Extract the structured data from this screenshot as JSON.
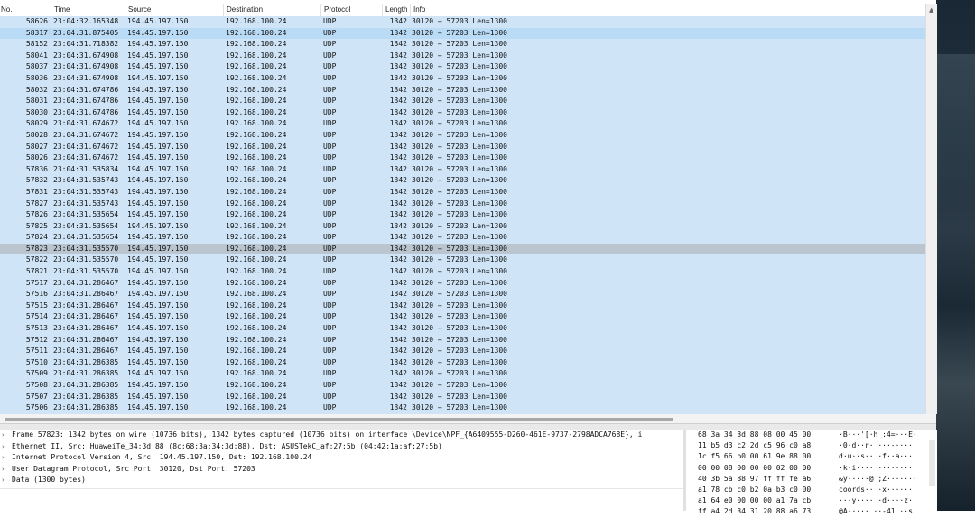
{
  "columns": {
    "no": "No.",
    "time": "Time",
    "source": "Source",
    "destination": "Destination",
    "protocol": "Protocol",
    "length": "Length",
    "info": "Info"
  },
  "colors": {
    "row_bg": "#cfe5f7",
    "selected_bg": "#bac5cf",
    "hover_bg": "#b9dbf6"
  },
  "packets": [
    {
      "no": "58626",
      "time": "23:04:32.165348",
      "source": "194.45.197.150",
      "destination": "192.168.100.24",
      "protocol": "UDP",
      "length": "1342",
      "info": "30120 → 57203 Len=1300"
    },
    {
      "no": "58317",
      "time": "23:04:31.875405",
      "source": "194.45.197.150",
      "destination": "192.168.100.24",
      "protocol": "UDP",
      "length": "1342",
      "info": "30120 → 57203 Len=1300"
    },
    {
      "no": "58152",
      "time": "23:04:31.718382",
      "source": "194.45.197.150",
      "destination": "192.168.100.24",
      "protocol": "UDP",
      "length": "1342",
      "info": "30120 → 57203 Len=1300"
    },
    {
      "no": "58041",
      "time": "23:04:31.674908",
      "source": "194.45.197.150",
      "destination": "192.168.100.24",
      "protocol": "UDP",
      "length": "1342",
      "info": "30120 → 57203 Len=1300"
    },
    {
      "no": "58037",
      "time": "23:04:31.674908",
      "source": "194.45.197.150",
      "destination": "192.168.100.24",
      "protocol": "UDP",
      "length": "1342",
      "info": "30120 → 57203 Len=1300"
    },
    {
      "no": "58036",
      "time": "23:04:31.674908",
      "source": "194.45.197.150",
      "destination": "192.168.100.24",
      "protocol": "UDP",
      "length": "1342",
      "info": "30120 → 57203 Len=1300"
    },
    {
      "no": "58032",
      "time": "23:04:31.674786",
      "source": "194.45.197.150",
      "destination": "192.168.100.24",
      "protocol": "UDP",
      "length": "1342",
      "info": "30120 → 57203 Len=1300"
    },
    {
      "no": "58031",
      "time": "23:04:31.674786",
      "source": "194.45.197.150",
      "destination": "192.168.100.24",
      "protocol": "UDP",
      "length": "1342",
      "info": "30120 → 57203 Len=1300"
    },
    {
      "no": "58030",
      "time": "23:04:31.674786",
      "source": "194.45.197.150",
      "destination": "192.168.100.24",
      "protocol": "UDP",
      "length": "1342",
      "info": "30120 → 57203 Len=1300"
    },
    {
      "no": "58029",
      "time": "23:04:31.674672",
      "source": "194.45.197.150",
      "destination": "192.168.100.24",
      "protocol": "UDP",
      "length": "1342",
      "info": "30120 → 57203 Len=1300"
    },
    {
      "no": "58028",
      "time": "23:04:31.674672",
      "source": "194.45.197.150",
      "destination": "192.168.100.24",
      "protocol": "UDP",
      "length": "1342",
      "info": "30120 → 57203 Len=1300"
    },
    {
      "no": "58027",
      "time": "23:04:31.674672",
      "source": "194.45.197.150",
      "destination": "192.168.100.24",
      "protocol": "UDP",
      "length": "1342",
      "info": "30120 → 57203 Len=1300"
    },
    {
      "no": "58026",
      "time": "23:04:31.674672",
      "source": "194.45.197.150",
      "destination": "192.168.100.24",
      "protocol": "UDP",
      "length": "1342",
      "info": "30120 → 57203 Len=1300"
    },
    {
      "no": "57836",
      "time": "23:04:31.535834",
      "source": "194.45.197.150",
      "destination": "192.168.100.24",
      "protocol": "UDP",
      "length": "1342",
      "info": "30120 → 57203 Len=1300"
    },
    {
      "no": "57832",
      "time": "23:04:31.535743",
      "source": "194.45.197.150",
      "destination": "192.168.100.24",
      "protocol": "UDP",
      "length": "1342",
      "info": "30120 → 57203 Len=1300"
    },
    {
      "no": "57831",
      "time": "23:04:31.535743",
      "source": "194.45.197.150",
      "destination": "192.168.100.24",
      "protocol": "UDP",
      "length": "1342",
      "info": "30120 → 57203 Len=1300"
    },
    {
      "no": "57827",
      "time": "23:04:31.535743",
      "source": "194.45.197.150",
      "destination": "192.168.100.24",
      "protocol": "UDP",
      "length": "1342",
      "info": "30120 → 57203 Len=1300"
    },
    {
      "no": "57826",
      "time": "23:04:31.535654",
      "source": "194.45.197.150",
      "destination": "192.168.100.24",
      "protocol": "UDP",
      "length": "1342",
      "info": "30120 → 57203 Len=1300"
    },
    {
      "no": "57825",
      "time": "23:04:31.535654",
      "source": "194.45.197.150",
      "destination": "192.168.100.24",
      "protocol": "UDP",
      "length": "1342",
      "info": "30120 → 57203 Len=1300"
    },
    {
      "no": "57824",
      "time": "23:04:31.535654",
      "source": "194.45.197.150",
      "destination": "192.168.100.24",
      "protocol": "UDP",
      "length": "1342",
      "info": "30120 → 57203 Len=1300"
    },
    {
      "no": "57823",
      "time": "23:04:31.535570",
      "source": "194.45.197.150",
      "destination": "192.168.100.24",
      "protocol": "UDP",
      "length": "1342",
      "info": "30120 → 57203 Len=1300"
    },
    {
      "no": "57822",
      "time": "23:04:31.535570",
      "source": "194.45.197.150",
      "destination": "192.168.100.24",
      "protocol": "UDP",
      "length": "1342",
      "info": "30120 → 57203 Len=1300"
    },
    {
      "no": "57821",
      "time": "23:04:31.535570",
      "source": "194.45.197.150",
      "destination": "192.168.100.24",
      "protocol": "UDP",
      "length": "1342",
      "info": "30120 → 57203 Len=1300"
    },
    {
      "no": "57517",
      "time": "23:04:31.286467",
      "source": "194.45.197.150",
      "destination": "192.168.100.24",
      "protocol": "UDP",
      "length": "1342",
      "info": "30120 → 57203 Len=1300"
    },
    {
      "no": "57516",
      "time": "23:04:31.286467",
      "source": "194.45.197.150",
      "destination": "192.168.100.24",
      "protocol": "UDP",
      "length": "1342",
      "info": "30120 → 57203 Len=1300"
    },
    {
      "no": "57515",
      "time": "23:04:31.286467",
      "source": "194.45.197.150",
      "destination": "192.168.100.24",
      "protocol": "UDP",
      "length": "1342",
      "info": "30120 → 57203 Len=1300"
    },
    {
      "no": "57514",
      "time": "23:04:31.286467",
      "source": "194.45.197.150",
      "destination": "192.168.100.24",
      "protocol": "UDP",
      "length": "1342",
      "info": "30120 → 57203 Len=1300"
    },
    {
      "no": "57513",
      "time": "23:04:31.286467",
      "source": "194.45.197.150",
      "destination": "192.168.100.24",
      "protocol": "UDP",
      "length": "1342",
      "info": "30120 → 57203 Len=1300"
    },
    {
      "no": "57512",
      "time": "23:04:31.286467",
      "source": "194.45.197.150",
      "destination": "192.168.100.24",
      "protocol": "UDP",
      "length": "1342",
      "info": "30120 → 57203 Len=1300"
    },
    {
      "no": "57511",
      "time": "23:04:31.286467",
      "source": "194.45.197.150",
      "destination": "192.168.100.24",
      "protocol": "UDP",
      "length": "1342",
      "info": "30120 → 57203 Len=1300"
    },
    {
      "no": "57510",
      "time": "23:04:31.286385",
      "source": "194.45.197.150",
      "destination": "192.168.100.24",
      "protocol": "UDP",
      "length": "1342",
      "info": "30120 → 57203 Len=1300"
    },
    {
      "no": "57509",
      "time": "23:04:31.286385",
      "source": "194.45.197.150",
      "destination": "192.168.100.24",
      "protocol": "UDP",
      "length": "1342",
      "info": "30120 → 57203 Len=1300"
    },
    {
      "no": "57508",
      "time": "23:04:31.286385",
      "source": "194.45.197.150",
      "destination": "192.168.100.24",
      "protocol": "UDP",
      "length": "1342",
      "info": "30120 → 57203 Len=1300"
    },
    {
      "no": "57507",
      "time": "23:04:31.286385",
      "source": "194.45.197.150",
      "destination": "192.168.100.24",
      "protocol": "UDP",
      "length": "1342",
      "info": "30120 → 57203 Len=1300"
    },
    {
      "no": "57506",
      "time": "23:04:31.286385",
      "source": "194.45.197.150",
      "destination": "192.168.100.24",
      "protocol": "UDP",
      "length": "1342",
      "info": "30120 → 57203 Len=1300"
    }
  ],
  "selected_no": "57823",
  "hover_no": "58317",
  "details": [
    {
      "arrow": "›",
      "text": "Frame 57823: 1342 bytes on wire (10736 bits), 1342 bytes captured (10736 bits) on interface \\Device\\NPF_{A6409555-D260-461E-9737-2798ADCA768E}, i"
    },
    {
      "arrow": "›",
      "text": "Ethernet II, Src: HuaweiTe_34:3d:88 (8c:68:3a:34:3d:88), Dst: ASUSTekC_af:27:5b (04:42:1a:af:27:5b)"
    },
    {
      "arrow": "›",
      "text": "Internet Protocol Version 4, Src: 194.45.197.150, Dst: 192.168.100.24"
    },
    {
      "arrow": "›",
      "text": "User Datagram Protocol, Src Port: 30120, Dst Port: 57203"
    },
    {
      "arrow": "›",
      "text": "Data (1300 bytes)"
    }
  ],
  "hex_dump": [
    {
      "hex": "68 3a 34 3d 88 08 00 45 00",
      "ascii": "·B···'[·h :4=···E·"
    },
    {
      "hex": "11 b5 d3 c2 2d c5 96 c0 a8",
      "ascii": "·0·d··r·  ···-····"
    },
    {
      "hex": "1c f5 66 b0 00 61 9e 88 00",
      "ascii": "d·u··s··  ·f··a···"
    },
    {
      "hex": "00 00 08 00 00 00 02 00 00",
      "ascii": "·k·i····  ········"
    },
    {
      "hex": "40 3b 5a 88 97 ff ff fe a6",
      "ascii": "&y·····@ ;Z·······"
    },
    {
      "hex": "a1 78 cb c0 b2 0a b3 c0 00",
      "ascii": "coords··  ·x······"
    },
    {
      "hex": "a1 64 e0 00 00 00 a1 7a cb",
      "ascii": "···y····  ·d····z·"
    },
    {
      "hex": "ff a4 2d 34 31 20 88 a6 73",
      "ascii": "@A·····  ··-41 ··s"
    }
  ]
}
